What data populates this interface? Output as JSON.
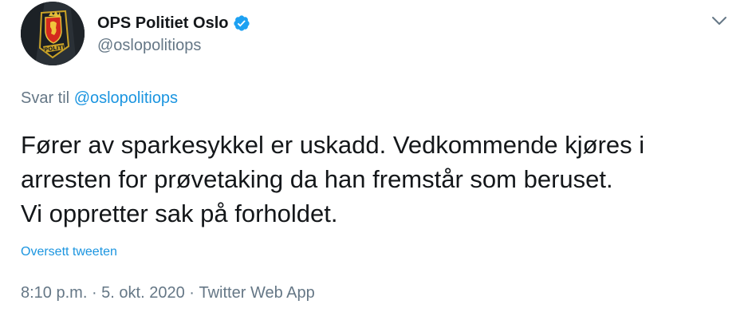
{
  "author": {
    "display_name": "OPS Politiet Oslo",
    "handle": "@oslopolitiops",
    "avatar_badge_text": "POLITI",
    "verified_color": "#1da1f2"
  },
  "menu": {
    "icon": "chevron-down-icon"
  },
  "reply": {
    "prefix": "Svar til",
    "mention": "@oslopolitiops"
  },
  "tweet": {
    "text": "Fører av sparkesykkel er uskadd. Vedkommende kjøres i\narresten for prøvetaking da han fremstår som beruset.\nVi oppretter sak på forholdet."
  },
  "translate": {
    "label": "Oversett tweeten"
  },
  "meta": {
    "time": "8:10 p.m.",
    "separator": " · ",
    "date": "5. okt. 2020",
    "source": "Twitter Web App"
  },
  "colors": {
    "text": "#14171a",
    "secondary": "#657786",
    "link": "#1b95e0"
  }
}
